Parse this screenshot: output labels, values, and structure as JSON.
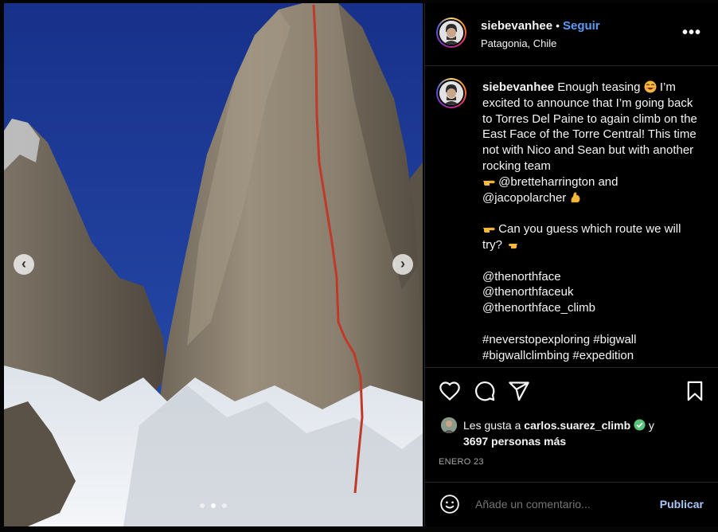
{
  "post": {
    "username": "siebevanhee",
    "separator": "•",
    "follow_label": "Seguir",
    "location": "Patagonia, Chile",
    "more_label": "•••"
  },
  "caption": {
    "username": "siebevanhee",
    "line1": "Enough teasing",
    "line1b": "I’m excited to announce that I’m going back to Torres Del Paine to again climb on the East Face of the Torre Central! This time not with Nico and Sean but with another rocking team",
    "mention1": "@bretteharrington and",
    "mention2": "@jacopolarcher",
    "question": "Can you guess which route we will try?",
    "tag1": "@thenorthface",
    "tag2": "@thenorthfaceuk",
    "tag3": "@thenorthface_climb",
    "hashtags": "#neverstopexploring #bigwall #bigwallclimbing #expedition"
  },
  "likes": {
    "prefix": "Les gusta a",
    "user": "carlos.suarez_climb",
    "conj": "y",
    "others": "3697 personas más"
  },
  "date": "ENERO 23",
  "comment": {
    "placeholder": "Añade un comentario...",
    "publish_label": "Publicar"
  },
  "carousel": {
    "prev_label": "‹",
    "next_label": "›"
  },
  "icons": {
    "like": "heart-icon",
    "comment": "comment-icon",
    "share": "share-icon",
    "save": "bookmark-icon",
    "emoji": "smiley-icon"
  },
  "colors": {
    "follow": "#5b9cf6",
    "route_line": "#c0392b",
    "verified": "#58c37a"
  }
}
